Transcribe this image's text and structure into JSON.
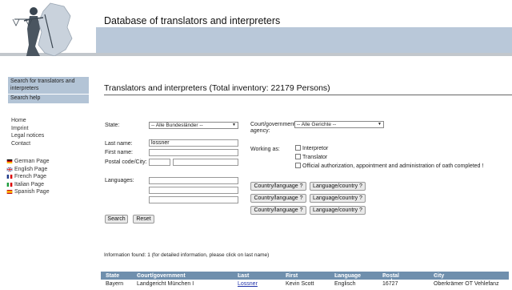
{
  "header": {
    "title": "Database of translators and interpreters"
  },
  "sidebar": {
    "nav": [
      {
        "label": "Search for translators and interpreters"
      },
      {
        "label": "Search help"
      }
    ],
    "links": [
      "Home",
      "Imprint",
      "Legal notices",
      "Contact"
    ],
    "languages": [
      {
        "label": "German Page",
        "flag": "german-flag-icon"
      },
      {
        "label": "English Page",
        "flag": "uk-flag-icon"
      },
      {
        "label": "French Page",
        "flag": "french-flag-icon"
      },
      {
        "label": "Italian Page",
        "flag": "italian-flag-icon"
      },
      {
        "label": "Spanish Page",
        "flag": "spanish-flag-icon"
      }
    ]
  },
  "main": {
    "title": "Translators and interpreters (Total inventory: 22179 Persons)",
    "form": {
      "state_label": "State:",
      "state_value": "-- Alle Bundesländer --",
      "court_label_1": "Court/government",
      "court_label_2": "agency:",
      "court_value": "-- Alle Gerichte --",
      "lastname_label": "Last name:",
      "lastname_value": "lossner",
      "firstname_label": "First name:",
      "firstname_value": "",
      "postal_label": "Postal code/City:",
      "working_label": "Working as:",
      "working_options": [
        "Interpretor",
        "Translator",
        "Official authorization, appointment and administration of oath completed !"
      ],
      "languages_label": "Languages:",
      "country_button": "Country/language ?",
      "language_button": "Language/country ?",
      "search_button": "Search",
      "reset_button": "Reset"
    },
    "info": "Information found: 1 (for detailed information, please click on last name)",
    "table": {
      "headers": [
        "State",
        "Court/government agency",
        "Last name",
        "First name",
        "Language",
        "Postal code",
        "City"
      ],
      "rows": [
        [
          "Bayern",
          "Landgericht München I",
          "Lossner",
          "Kevin Scott",
          "Englisch",
          "16727",
          "Oberkrämer OT Vehlefanz"
        ]
      ]
    }
  },
  "colors": {
    "band": "#b9c8d9",
    "table_header": "#6f8fad",
    "nav_bg": "#b3c4d6"
  }
}
